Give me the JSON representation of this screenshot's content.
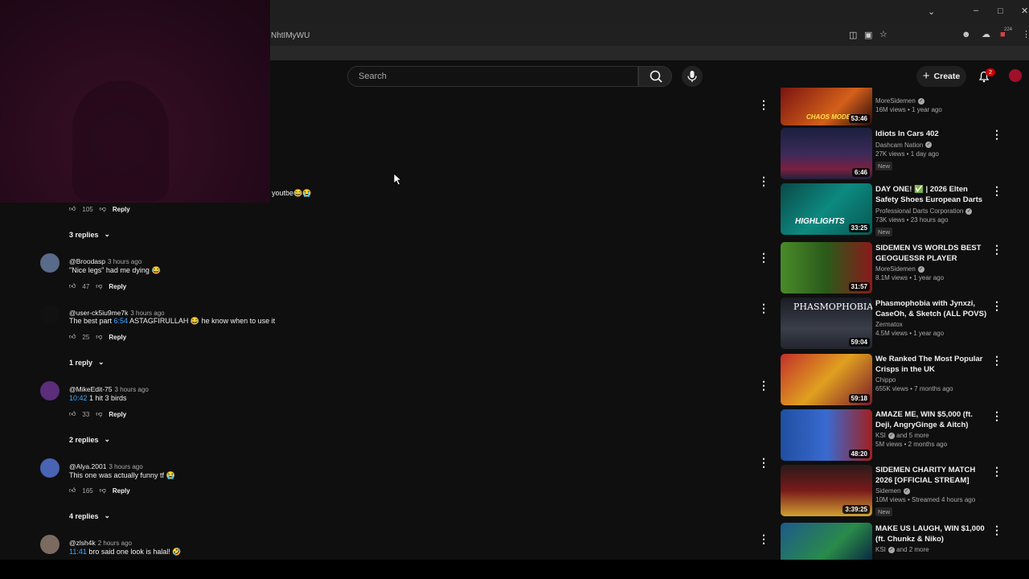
{
  "browser": {
    "url_fragment": "NhtIMyWU",
    "extension_badge": "224"
  },
  "header": {
    "search_placeholder": "Search",
    "create_label": "Create",
    "notifications_count": "2"
  },
  "partial_comment": {
    "text_tail": "youtbe😂😭",
    "likes": "105",
    "reply_label": "Reply",
    "replies_label": "3 replies"
  },
  "comments": [
    {
      "author": "@Broodasp",
      "time": "3 hours ago",
      "timestamp": "",
      "text": "\"Nice legs\" had me dying 😂",
      "likes": "47",
      "reply_label": "Reply",
      "replies_label": "",
      "avatar_color": "#5a6a8a"
    },
    {
      "author": "@user-ck5iu9me7k",
      "time": "3 hours ago",
      "timestamp": "",
      "text_before": "The best part ",
      "ts": "6:54",
      "text_after": " ASTAGFIRULLAH 😂 he know when to use it",
      "likes": "25",
      "reply_label": "Reply",
      "replies_label": "1 reply",
      "avatar_color": "#111111"
    },
    {
      "author": "@MikeEdit-75",
      "time": "3 hours ago",
      "ts": "10:42",
      "text_after": " 1 hit 3 birds",
      "likes": "33",
      "reply_label": "Reply",
      "replies_label": "2 replies",
      "avatar_color": "#5b2d7a"
    },
    {
      "author": "@Alya.2001",
      "time": "3 hours ago",
      "text": "This one was actually funny tf 😭",
      "likes": "165",
      "reply_label": "Reply",
      "replies_label": "4 replies",
      "avatar_color": "#4a64b4"
    },
    {
      "author": "@zlsh4k",
      "time": "2 hours ago",
      "ts": "11:41",
      "text_after": " bro said one look is halal! 🤣",
      "avatar_color": "#7a6a60"
    }
  ],
  "videos": [
    {
      "title": "",
      "channel": "MoreSidemen",
      "verified": true,
      "meta": "16M views • 1 year ago",
      "duration": "53:46",
      "new": false,
      "thumb_color": "#7a1410",
      "thumb_text": "CHAOS MODE"
    },
    {
      "title": "Idiots In Cars 402",
      "channel": "Dashcam Nation",
      "verified": true,
      "meta": "27K views • 1 day ago",
      "duration": "6:46",
      "new": true,
      "new_label": "New",
      "thumb_color": "#2a2d55",
      "thumb_text": ""
    },
    {
      "title": "DAY ONE! ✅ | 2026 Elten Safety Shoes European Darts ...",
      "channel": "Professional Darts Corporation",
      "verified": true,
      "meta": "73K views • 23 hours ago",
      "duration": "33:25",
      "new": true,
      "new_label": "New",
      "thumb_color": "#0d6e6a",
      "thumb_text": "HIGHLIGHTS"
    },
    {
      "title": "SIDEMEN VS WORLDS BEST GEOGUESSR PLAYER",
      "channel": "MoreSidemen",
      "verified": true,
      "meta": "8.1M views • 1 year ago",
      "duration": "31:57",
      "new": false,
      "thumb_color": "#3a7a2a",
      "thumb_text": ""
    },
    {
      "title": "Phasmophobia with Jynxzi, CaseOh, & Sketch (ALL POVS)",
      "channel": "Zermatox",
      "verified": false,
      "meta": "4.5M views • 1 year ago",
      "duration": "59:04",
      "new": false,
      "thumb_color": "#2b2f3a",
      "thumb_text": "PHASMOPHOBIA"
    },
    {
      "title": "We Ranked The Most Popular Crisps in the UK",
      "channel": "Chippo",
      "verified": false,
      "meta": "655K views • 7 months ago",
      "duration": "59:18",
      "new": false,
      "thumb_color": "#b84a20",
      "thumb_text": ""
    },
    {
      "title": "AMAZE ME, WIN $5,000 (ft. Deji, AngryGinge & Aitch)",
      "channel": "KSI",
      "channel_extra": "and 5 more",
      "verified": true,
      "meta": "5M views • 2 months ago",
      "duration": "48:20",
      "new": false,
      "thumb_color": "#1f4fa0",
      "thumb_text": ""
    },
    {
      "title": "SIDEMEN CHARITY MATCH 2026 [OFFICIAL STREAM]",
      "channel": "Sidemen",
      "verified": true,
      "meta": "10M views • Streamed 4 hours ago",
      "duration": "3:39:25",
      "new": true,
      "new_label": "New",
      "thumb_color": "#7a1a1a",
      "thumb_text": ""
    },
    {
      "title": "MAKE US LAUGH, WIN $1,000 (ft. Chunkz & Niko)",
      "channel": "KSI",
      "channel_extra": "and 2 more",
      "verified": true,
      "meta": "",
      "duration": "",
      "new": false,
      "thumb_color": "#1d5a8a",
      "thumb_text": ""
    }
  ]
}
